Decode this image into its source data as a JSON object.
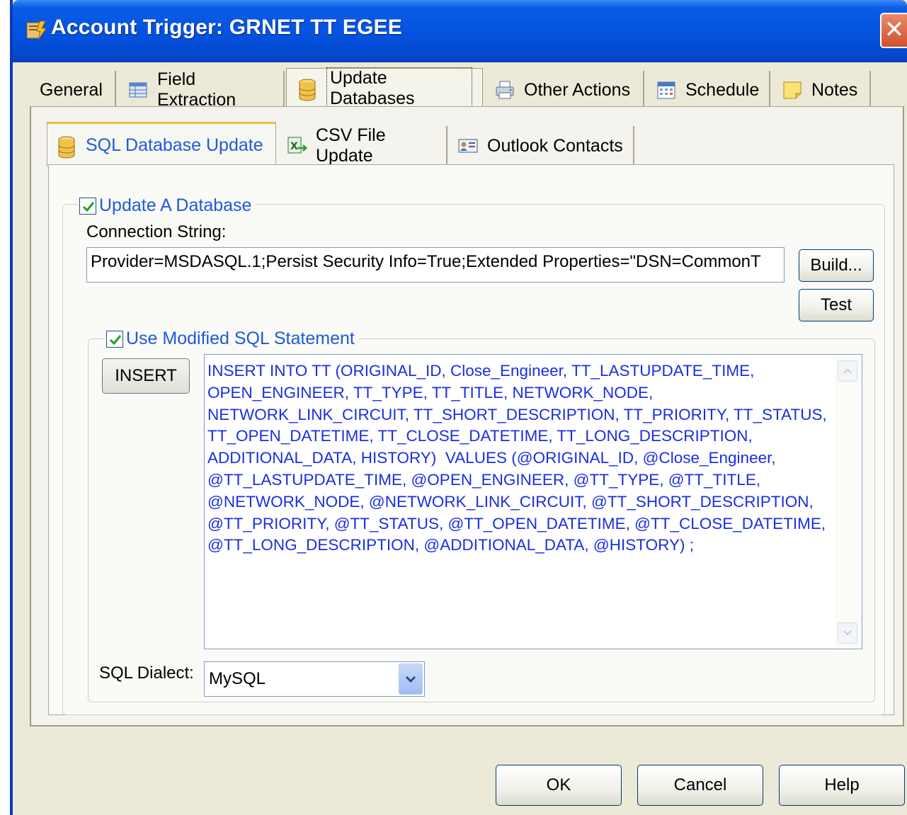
{
  "window": {
    "title": "Account Trigger: GRNET TT EGEE",
    "close_glyph": "✕"
  },
  "tabs": [
    {
      "label": "General",
      "icon": ""
    },
    {
      "label": "Field Extraction",
      "icon": "table-icon"
    },
    {
      "label": "Update Databases",
      "icon": "database-icon",
      "active": true
    },
    {
      "label": "Other Actions",
      "icon": "printer-icon"
    },
    {
      "label": "Schedule",
      "icon": "calendar-icon"
    },
    {
      "label": "Notes",
      "icon": "note-icon"
    }
  ],
  "subtabs": [
    {
      "label": "SQL Database Update",
      "icon": "database-icon",
      "active": true
    },
    {
      "label": "CSV File Update",
      "icon": "excel-icon"
    },
    {
      "label": "Outlook Contacts",
      "icon": "contact-card-icon"
    }
  ],
  "update_db": {
    "checkbox_label": "Update A Database",
    "checked": true,
    "connection_label": "Connection String:",
    "connection_value": "Provider=MSDASQL.1;Persist Security Info=True;Extended Properties=\"DSN=CommonT",
    "build_label": "Build...",
    "test_label": "Test"
  },
  "modified_sql": {
    "checkbox_label": "Use Modified SQL Statement",
    "checked": true,
    "insert_label": "INSERT",
    "statement": "INSERT INTO TT (ORIGINAL_ID, Close_Engineer, TT_LASTUPDATE_TIME, OPEN_ENGINEER, TT_TYPE, TT_TITLE, NETWORK_NODE, NETWORK_LINK_CIRCUIT, TT_SHORT_DESCRIPTION, TT_PRIORITY, TT_STATUS, TT_OPEN_DATETIME, TT_CLOSE_DATETIME, TT_LONG_DESCRIPTION, ADDITIONAL_DATA, HISTORY)  VALUES (@ORIGINAL_ID, @Close_Engineer, @TT_LASTUPDATE_TIME, @OPEN_ENGINEER, @TT_TYPE, @TT_TITLE, @NETWORK_NODE, @NETWORK_LINK_CIRCUIT, @TT_SHORT_DESCRIPTION, @TT_PRIORITY, @TT_STATUS, @TT_OPEN_DATETIME, @TT_CLOSE_DATETIME, @TT_LONG_DESCRIPTION, @ADDITIONAL_DATA, @HISTORY) ;",
    "dialect_label": "SQL Dialect:",
    "dialect_value": "MySQL"
  },
  "footer": {
    "ok_label": "OK",
    "cancel_label": "Cancel",
    "help_label": "Help"
  },
  "colors": {
    "titlebar": "#0553e0",
    "dialog_bg": "#ece9d8",
    "link_blue": "#1f5ad8",
    "sql_text": "#1a2fe0"
  }
}
